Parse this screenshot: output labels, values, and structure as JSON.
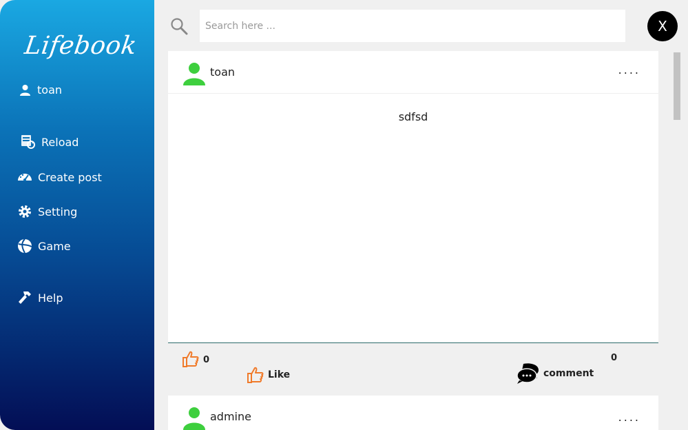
{
  "app": {
    "logo": "Lifebook"
  },
  "sidebar": {
    "user": {
      "name": "toan",
      "icon": "user-icon"
    },
    "items": [
      {
        "label": "Reload",
        "icon": "reload-icon"
      },
      {
        "label": "Create post",
        "icon": "dashboard-icon"
      },
      {
        "label": "Setting",
        "icon": "gear-icon"
      },
      {
        "label": "Game",
        "icon": "game-icon"
      },
      {
        "label": "Help",
        "icon": "hammer-icon"
      }
    ]
  },
  "search": {
    "placeholder": "Search here ..."
  },
  "close": {
    "label": "X"
  },
  "posts": [
    {
      "author": "toan",
      "menu": "....",
      "text": "sdfsd",
      "likes": "0",
      "like_label": "Like",
      "comments": "0",
      "comment_label": "comment"
    },
    {
      "author": "admine",
      "menu": "...."
    }
  ],
  "colors": {
    "sidebar_top": "#1aa8e2",
    "sidebar_bottom": "#030e55",
    "avatar_green": "#3ecf3e",
    "like_orange": "#f07a2a"
  }
}
